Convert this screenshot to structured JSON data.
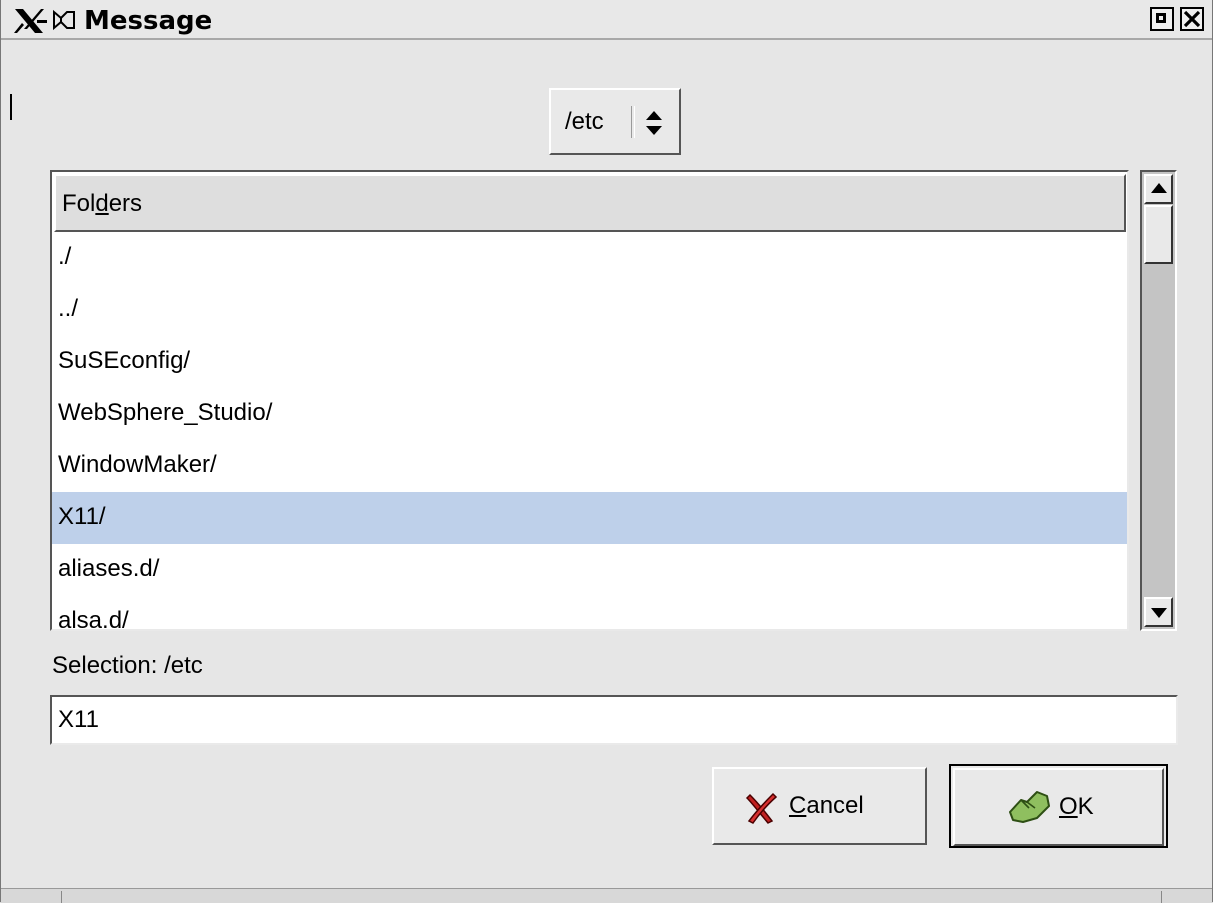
{
  "window": {
    "title": "Message"
  },
  "titlebar": {
    "icons": [
      "x-logo-icon",
      "tie-icon"
    ],
    "buttons": [
      "maximize-icon",
      "close-icon"
    ]
  },
  "folder_combo": {
    "current": "/etc"
  },
  "folders": {
    "header_pre": "Fol",
    "header_mnemonic": "d",
    "header_post": "ers",
    "items": [
      "./",
      "../",
      "SuSEconfig/",
      "WebSphere_Studio/",
      "WindowMaker/",
      "X11/",
      "aliases.d/",
      "alsa.d/"
    ],
    "selected": "X11/"
  },
  "selection": {
    "label": "Selection: /etc",
    "value": "X11"
  },
  "buttons": {
    "cancel_mnemonic": "C",
    "cancel_rest": "ancel",
    "ok_mnemonic": "O",
    "ok_rest": "K"
  },
  "colors": {
    "selection_highlight": "#bed0ea",
    "background": "#e6e6e6"
  }
}
